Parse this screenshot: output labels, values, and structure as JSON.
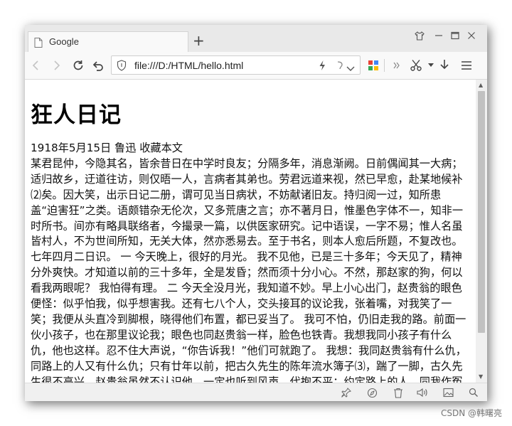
{
  "tab": {
    "title": "Google"
  },
  "address_bar": {
    "url": "file:///D:/HTML/hello.html"
  },
  "page": {
    "heading": "狂人日记",
    "meta": "1918年5月15日 鲁迅 收藏本文",
    "body": "某君昆仲，今隐其名，皆余昔日在中学时良友；分隔多年，消息渐阙。日前偶闻其一大病；适归故乡，迂道往访，则仅晤一人，言病者其弟也。劳君远道来视，然已早愈，赴某地候补⑵矣。因大笑，出示日记二册，谓可见当日病状，不妨献诸旧友。持归阅一过，知所患盖“迫害狂”之类。语颇错杂无伦次，又多荒唐之言；亦不著月日，惟墨色字体不一，知非一时所书。间亦有略具联络者，今撮录一篇，以供医家研究。记中语误，一字不易；惟人名虽皆村人，不为世间所知，无关大体，然亦悉易去。至于书名，则本人愈后所题，不复改也。七年四月二日识。 一 今天晚上，很好的月光。 我不见他，已是三十多年；今天见了，精神分外爽快。才知道以前的三十多年，全是发昏；然而须十分小心。不然，那赵家的狗，何以看我两眼呢？ 我怕得有理。 二 今天全没月光，我知道不妙。早上小心出门，赵贵翁的眼色便怪：似乎怕我，似乎想害我。还有七八个人，交头接耳的议论我，张着嘴，对我笑了一笑；我便从头直冷到脚根，晓得他们布置，都已妥当了。 我可不怕，仍旧走我的路。前面一伙小孩子，也在那里议论我；眼色也同赵贵翁一样，脸色也铁青。我想我同小孩子有什么仇，他也这样。忍不住大声说，“你告诉我！”他们可就跑了。 我想：我同赵贵翁有什么仇，同路上的人又有什么仇；只有廿年以前，把古久先生的陈年流水簿子⑶，踹了一脚，古久先生很不高兴。赵贵翁虽然不认识他，一定也听到风声，代抱不平；约定路上的人，同我作冤对。但是小孩子呢？"
  },
  "watermark": "CSDN @韩曙亮"
}
